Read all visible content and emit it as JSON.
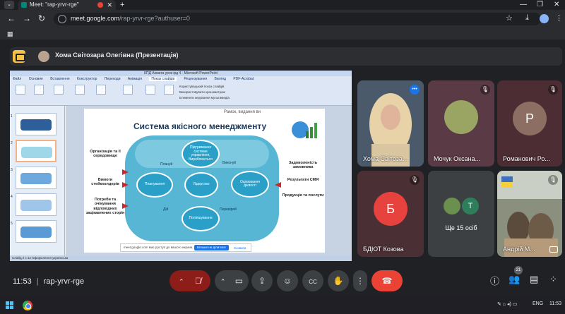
{
  "browser": {
    "tab_title": "Meet: \"rap-yrvr-rge\"",
    "tab_menu": "⌄",
    "tab_close": "✕",
    "new_tab": "+",
    "url_host": "meet.google.com",
    "url_path": "/rap-yrvr-rge?authuser=0",
    "minimize": "—",
    "restore": "❐",
    "close": "✕"
  },
  "presenter": {
    "name": "Хома Світозара Олегівна (Презентація)"
  },
  "slide": {
    "title": "Система якісного менеджменту",
    "top_text": "Рамок, видання ви",
    "nodes": {
      "top": "Підтримання системи управління, Вироблюється",
      "left": "Планування",
      "center": "Лідерство",
      "right": "Оцінювання дієвості",
      "bottom": "Поліпшування"
    },
    "minis": {
      "plan": "Плануй",
      "check": "Виконуй",
      "act": "Дій",
      "verify": "Перевіряй"
    },
    "left_labels": [
      "Організація та її середовище",
      "Вимоги стейкхолдерів",
      "Потреби та очікування відповідних зацікавлених сторін"
    ],
    "right_labels": [
      "Задоволеність замовника",
      "Результати СМЯ",
      "Продукція та послуги"
    ]
  },
  "powerpoint": {
    "window_title": "КПД Ахмата урок ірд 4 - Microsoft PowerPoint",
    "tabs": [
      "Файл",
      "Основне",
      "Вставлення",
      "Конструктор",
      "Переходи",
      "Анімація",
      "Показ слайдів",
      "Рецензування",
      "Вигляд",
      "PDF-Acrobat"
    ],
    "active_tab": "Показ слайдів",
    "checks": [
      "Користувацький показ слайдів",
      "Використовувати хронометраж",
      "Елементи керування мультимедіа"
    ],
    "status": "Слайд 2 з 12  Оформлення  українська",
    "share_note": "meet.google.com має доступ до вашого екрана.",
    "share_stop": "Більше не ділитися",
    "share_hide": "Сховати"
  },
  "tiles": [
    {
      "name": "Хома Світоза...",
      "letter": ""
    },
    {
      "name": "Мочук Оксана...",
      "letter": ""
    },
    {
      "name": "Романович Ро...",
      "letter": "Р"
    },
    {
      "name": "БДЮТ Козова",
      "letter": "Б"
    },
    {
      "name": "Ще 15 осіб",
      "letter": "Т"
    },
    {
      "name": "Андрій М...",
      "letter": ""
    }
  ],
  "meeting": {
    "time": "11:53",
    "code": "rap-yrvr-rge",
    "participants_count": "21"
  },
  "os": {
    "lang": "ENG",
    "clock": "11:53"
  },
  "colors": {
    "meet_bg": "#202124",
    "end_call": "#ea4335",
    "accent": "#1a73e8",
    "presenter_icon": "#f6c344"
  }
}
